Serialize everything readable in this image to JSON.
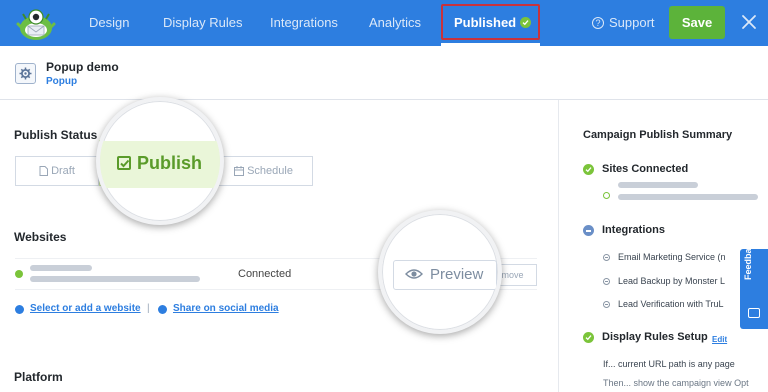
{
  "colors": {
    "nav_bg": "#2d7ee0",
    "save_bg": "#5cb33a",
    "accent_green": "#7bc43a",
    "highlight_border": "#c8323c"
  },
  "nav": {
    "tabs": [
      {
        "label": "Design"
      },
      {
        "label": "Display Rules"
      },
      {
        "label": "Integrations"
      },
      {
        "label": "Analytics"
      },
      {
        "label": "Published"
      }
    ],
    "support_label": "Support",
    "save_label": "Save",
    "icons": {
      "logo": "optinmonster-logo-icon",
      "support": "question-circle-icon",
      "close": "close-icon",
      "published_check": "check-circle-icon"
    }
  },
  "campaign": {
    "title": "Popup demo",
    "type": "Popup",
    "icon": "gear-icon"
  },
  "publish_status": {
    "heading": "Publish Status",
    "options": {
      "draft": "Draft",
      "publish": "Publish",
      "schedule": "Schedule"
    }
  },
  "websites": {
    "heading": "Websites",
    "rows": [
      {
        "status": "Connected",
        "preview_label": "Preview",
        "remove_label": "Remove"
      }
    ],
    "links": {
      "add": "Select or add a website",
      "share": "Share on social media",
      "separator": "|"
    }
  },
  "platform": {
    "heading": "Platform"
  },
  "summary": {
    "title": "Campaign Publish Summary",
    "sites_heading": "Sites Connected",
    "integrations_heading": "Integrations",
    "integrations": [
      "Email Marketing Service (n",
      "Lead Backup by Monster L",
      "Lead Verification with TruL"
    ],
    "display_rules_heading": "Display Rules Setup",
    "edit_label": "Edit",
    "rules": [
      "If... current URL path is any page",
      "Then... show the campaign view Opt"
    ]
  },
  "feedback": {
    "label": "Feedback"
  }
}
